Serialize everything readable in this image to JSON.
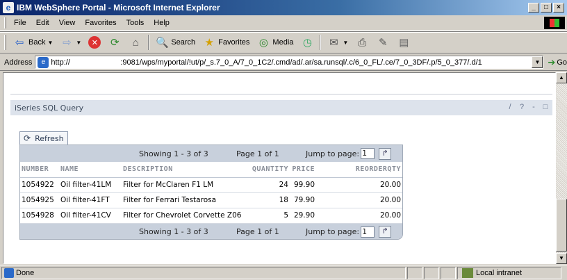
{
  "window": {
    "title": "IBM WebSphere Portal - Microsoft Internet Explorer",
    "buttons": [
      "_",
      "□",
      "×"
    ]
  },
  "menu": {
    "items": [
      "File",
      "Edit",
      "View",
      "Favorites",
      "Tools",
      "Help"
    ]
  },
  "toolbar": {
    "back": "Back",
    "search": "Search",
    "favorites": "Favorites",
    "media": "Media"
  },
  "address": {
    "label": "Address",
    "protocol": "http://",
    "path": ":9081/wps/myportal/!ut/p/_s.7_0_A/7_0_1C2/.cmd/ad/.ar/sa.runsql/.c/6_0_FL/.ce/7_0_3DF/.p/5_0_377/.d/1",
    "go": "Go"
  },
  "portlet": {
    "title": "iSeries SQL Query",
    "controls": [
      "/",
      "?",
      "-",
      "□"
    ],
    "refresh_label": "Refresh"
  },
  "pager": {
    "showing": "Showing 1 - 3 of 3",
    "page": "Page 1 of 1",
    "jump_label": "Jump to page:",
    "jump_value": "1"
  },
  "table": {
    "columns": [
      "NUMBER",
      "NAME",
      "DESCRIPTION",
      "QUANTITY",
      "PRICE",
      "REORDERQTY"
    ],
    "rows": [
      [
        "1054922",
        "Oil filter-41LM",
        "Filter for McClaren F1 LM",
        "24",
        "99.90",
        "20.00"
      ],
      [
        "1054925",
        "Oil filter-41FT",
        "Filter for Ferrari Testarosa",
        "18",
        "79.90",
        "20.00"
      ],
      [
        "1054928",
        "Oil filter-41CV",
        "Filter for Chevrolet Corvette Z06",
        "5",
        "29.90",
        "20.00"
      ]
    ]
  },
  "status": {
    "text": "Done",
    "zone": "Local intranet"
  },
  "colors": {
    "titlebar": "#0a246a",
    "portlet_bar": "#dde3ec",
    "pager_bg": "#c8d0dc"
  }
}
